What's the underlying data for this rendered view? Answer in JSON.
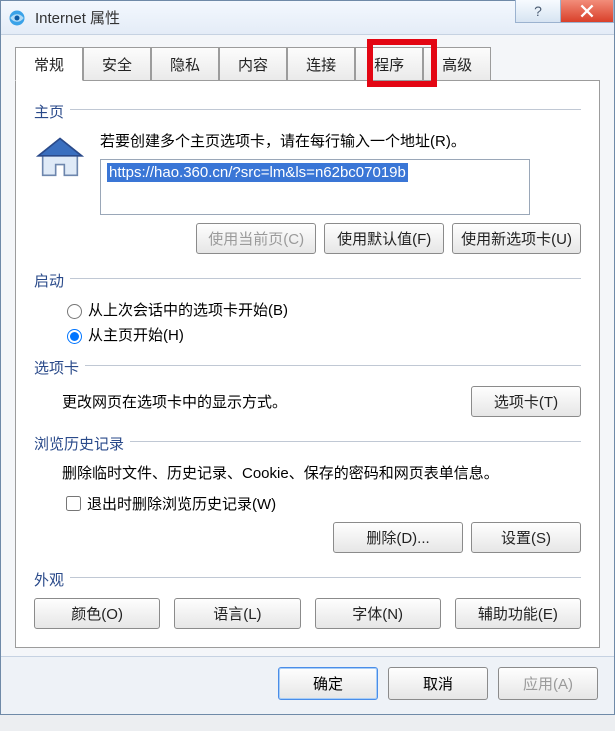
{
  "window": {
    "title": "Internet 属性"
  },
  "tabs": {
    "general": "常规",
    "security": "安全",
    "privacy": "隐私",
    "content": "内容",
    "connections": "连接",
    "programs": "程序",
    "advanced": "高级"
  },
  "homepage": {
    "section": "主页",
    "desc": "若要创建多个主页选项卡，请在每行输入一个地址(R)。",
    "url": "https://hao.360.cn/?src=lm&ls=n62bc07019b",
    "use_current": "使用当前页(C)",
    "use_default": "使用默认值(F)",
    "use_newtab": "使用新选项卡(U)"
  },
  "startup": {
    "section": "启动",
    "from_last": "从上次会话中的选项卡开始(B)",
    "from_home": "从主页开始(H)"
  },
  "tabs_section": {
    "section": "选项卡",
    "desc": "更改网页在选项卡中的显示方式。",
    "button": "选项卡(T)"
  },
  "history": {
    "section": "浏览历史记录",
    "desc": "删除临时文件、历史记录、Cookie、保存的密码和网页表单信息。",
    "delete_on_exit": "退出时删除浏览历史记录(W)",
    "delete": "删除(D)...",
    "settings": "设置(S)"
  },
  "appearance": {
    "section": "外观",
    "colors": "颜色(O)",
    "languages": "语言(L)",
    "fonts": "字体(N)",
    "accessibility": "辅助功能(E)"
  },
  "footer": {
    "ok": "确定",
    "cancel": "取消",
    "apply": "应用(A)"
  }
}
